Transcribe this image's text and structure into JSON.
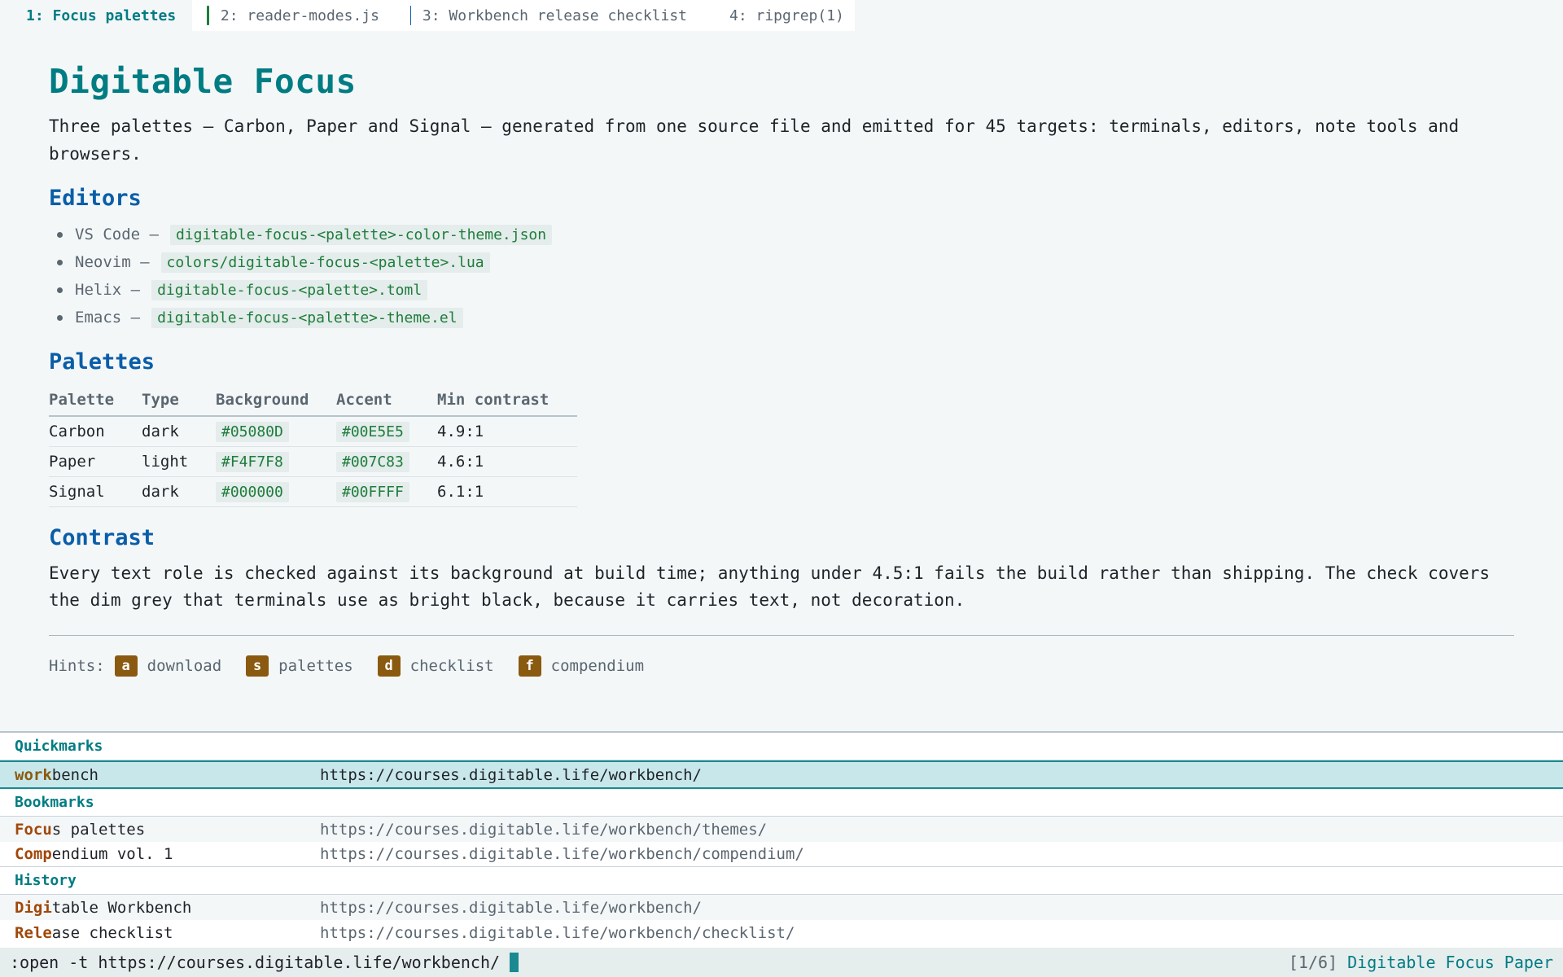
{
  "tabs": [
    {
      "label": "1: Focus palettes",
      "color": "#1e7d3a"
    },
    {
      "label": "2: reader-modes.js",
      "color": "#1e7d3a"
    },
    {
      "label": "3: Workbench release checklist",
      "color": "#0a5ea8"
    },
    {
      "label": "4: ripgrep(1)",
      "color": "#c4282d"
    }
  ],
  "page": {
    "title": "Digitable Focus",
    "lead": "Three palettes — Carbon, Paper and Signal — generated from one source file and emitted for 45 targets: terminals, editors, note tools and browsers.",
    "editors_heading": "Editors",
    "editors": [
      {
        "name": "VS Code —",
        "file": "digitable-focus-<palette>-color-theme.json"
      },
      {
        "name": "Neovim —",
        "file": "colors/digitable-focus-<palette>.lua"
      },
      {
        "name": "Helix —",
        "file": "digitable-focus-<palette>.toml"
      },
      {
        "name": "Emacs —",
        "file": "digitable-focus-<palette>-theme.el"
      }
    ],
    "palettes_heading": "Palettes",
    "table_headers": [
      "Palette",
      "Type",
      "Background",
      "Accent",
      "Min contrast"
    ],
    "table_rows": [
      [
        "Carbon",
        "dark",
        "#05080D",
        "#00E5E5",
        "4.9:1"
      ],
      [
        "Paper",
        "light",
        "#F4F7F8",
        "#007C83",
        "4.6:1"
      ],
      [
        "Signal",
        "dark",
        "#000000",
        "#00FFFF",
        "6.1:1"
      ]
    ],
    "contrast_heading": "Contrast",
    "contrast_text": "Every text role is checked against its background at build time; anything under 4.5:1 fails the build rather than shipping. The check covers the dim grey that terminals use as bright black, because it carries text, not decoration.",
    "hints_label": "Hints:",
    "hints": [
      {
        "key": "a",
        "label": "download"
      },
      {
        "key": "s",
        "label": "palettes"
      },
      {
        "key": "d",
        "label": "checklist"
      },
      {
        "key": "f",
        "label": "compendium"
      }
    ]
  },
  "completion": {
    "quickmarks_label": "Quickmarks",
    "quickmark": {
      "match": "work",
      "rest": "bench",
      "url": "https://courses.digitable.life/workbench/"
    },
    "bookmarks_label": "Bookmarks",
    "bookmarks": [
      {
        "match": "Focu",
        "rest": "s palettes",
        "url": "https://courses.digitable.life/workbench/themes/"
      },
      {
        "match": "Comp",
        "rest": "endium vol. 1",
        "url": "https://courses.digitable.life/workbench/compendium/"
      }
    ],
    "history_label": "History",
    "history": [
      {
        "match": "Digi",
        "rest": "table Workbench",
        "url": "https://courses.digitable.life/workbench/"
      },
      {
        "match": "Rele",
        "rest": "ase checklist",
        "url": "https://courses.digitable.life/workbench/checklist/"
      }
    ]
  },
  "cmdline": {
    "text": ":open -t https://courses.digitable.life/workbench/",
    "position": "[1/6]",
    "title": "Digitable Focus Paper"
  },
  "colors": {
    "background": "#F4F7F8",
    "accent": "#007C83",
    "heading": "#0a5ea8",
    "hint_key": "#8a5a10"
  }
}
